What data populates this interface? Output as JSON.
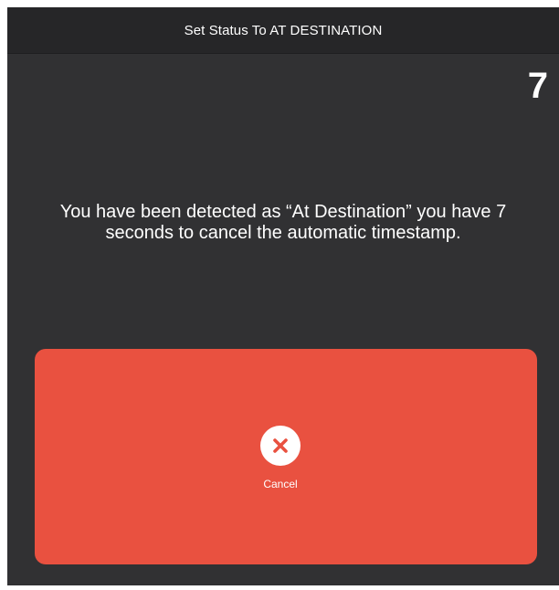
{
  "dialog": {
    "title": "Set Status To AT DESTINATION",
    "countdown": "7",
    "message": "You have been detected as “At Destination” you have 7 seconds to cancel the automatic timestamp."
  },
  "cancel_action": {
    "label": "Cancel",
    "icon": "close-icon",
    "background_color": "#e95140",
    "icon_color": "#e95140"
  },
  "theme": {
    "panel_color": "#313133",
    "title_bar_color": "#262628",
    "text_color": "#ffffff"
  }
}
